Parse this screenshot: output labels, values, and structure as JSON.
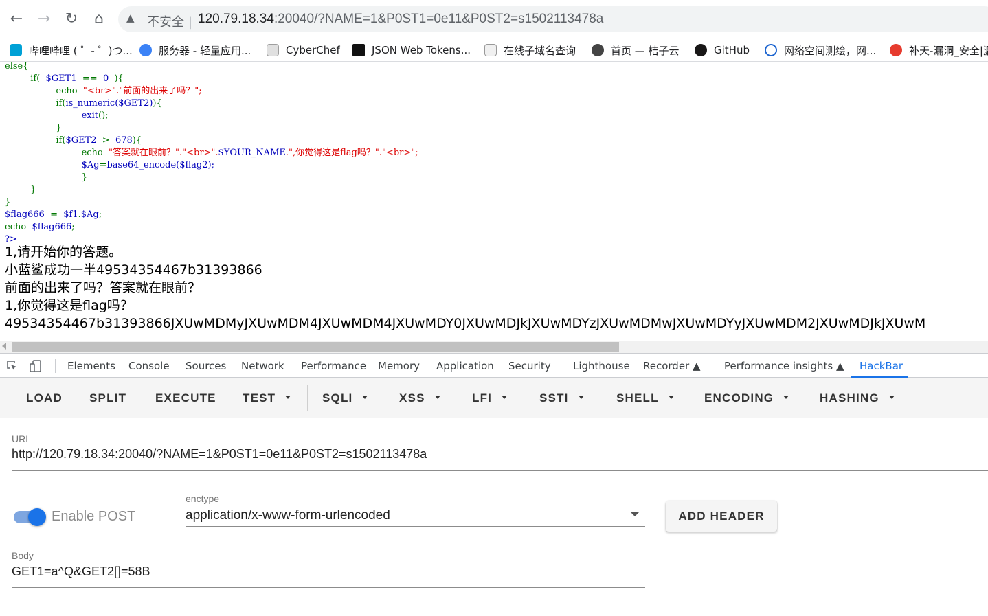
{
  "browser": {
    "address": {
      "warning_icon": "warning-triangle-icon",
      "insecure_label": "不安全",
      "separator": "|",
      "host": "120.79.18.34",
      "rest": ":20040/?NAME=1&P0ST1=0e11&P0ST2=s1502113478a"
    },
    "bookmarks": [
      {
        "label": "哔哩哔哩 ( ゜- ゜)つ...",
        "color": "#00a1d6"
      },
      {
        "label": "服务器 - 轻量应用...",
        "color": "#3b82f6"
      },
      {
        "label": "CyberChef",
        "color": "#9e9e9e"
      },
      {
        "label": "JSON Web Tokens...",
        "color": "#111111"
      },
      {
        "label": "在线子域名查询",
        "color": "#d4d4d4"
      },
      {
        "label": "首页 — 桔子云",
        "color": "#444444"
      },
      {
        "label": "GitHub",
        "color": "#181717"
      },
      {
        "label": "网络空间测绘，网...",
        "color": "#1e66d0"
      },
      {
        "label": "补天-漏洞_安全|漏",
        "color": "#e63b2e"
      }
    ]
  },
  "page": {
    "code": {
      "l1": "else{",
      "l2_kw": "if(  ",
      "l2_var": "$GET1  ",
      "l2_op": "==  ",
      "l2_num": "0  ",
      "l2_end": "){",
      "l3_kw": "echo  ",
      "l3_str": "\"<br>\".\"前面的出来了吗？\";",
      "l4_kw": "if(",
      "l4_fn": "is_numeric",
      "l4_arg": "($GET2)",
      "l4_end": "){",
      "l5_fn": "exit",
      "l5_end": "();",
      "l6": "}",
      "l7_kw": "if(",
      "l7_var": "$GET2  ",
      "l7_op": ">  ",
      "l7_num": "678",
      "l7_end": "){",
      "l8_kw": "echo  ",
      "l8_str": "\"答案就在眼前？\".\"<br>\".",
      "l8_var": "$YOUR_NAME",
      "l8_str2": ".\",你觉得这是flag吗？\".\"<br>\";",
      "l9_var": "$Ag",
      "l9_op": "=",
      "l9_fn": "base64_encode",
      "l9_arg": "($flag2);",
      "l10": "}",
      "l11": "}",
      "l12": "}",
      "l13_var": "$flag666  ",
      "l13_op": "=  ",
      "l13_var2": "$f1",
      "l13_op2": ".",
      "l13_var3": "$Ag",
      "l13_end": ";",
      "l14_kw": "echo  ",
      "l14_var": "$flag666",
      "l14_end": ";",
      "l15": "?>"
    },
    "output": [
      "1,请开始你的答题。",
      "小蓝鲨成功一半49534354467b31393866",
      "前面的出来了吗？答案就在眼前？",
      "1,你觉得这是flag吗？",
      "49534354467b31393866JXUwMDMyJXUwMDM4JXUwMDM4JXUwMDY0JXUwMDJkJXUwMDYzJXUwMDMwJXUwMDYyJXUwMDM2JXUwMDJkJXUwM"
    ]
  },
  "devtools": {
    "tabs": [
      "Elements",
      "Console",
      "Sources",
      "Network",
      "Performance",
      "Memory",
      "Application",
      "Security",
      "Lighthouse",
      "Recorder",
      "Performance insights",
      "HackBar"
    ],
    "active_tab": "HackBar"
  },
  "hackbar": {
    "buttons": [
      "LOAD",
      "SPLIT",
      "EXECUTE",
      "TEST",
      "SQLI",
      "XSS",
      "LFI",
      "SSTI",
      "SHELL",
      "ENCODING",
      "HASHING"
    ],
    "url_label": "URL",
    "url_value": "http://120.79.18.34:20040/?NAME=1&P0ST1=0e11&P0ST2=s1502113478a",
    "enable_post_label": "Enable POST",
    "enable_post": true,
    "enctype_label": "enctype",
    "enctype_value": "application/x-www-form-urlencoded",
    "add_header_label": "ADD HEADER",
    "body_label": "Body",
    "body_value": "GET1=a^Q&GET2[]=58B"
  }
}
